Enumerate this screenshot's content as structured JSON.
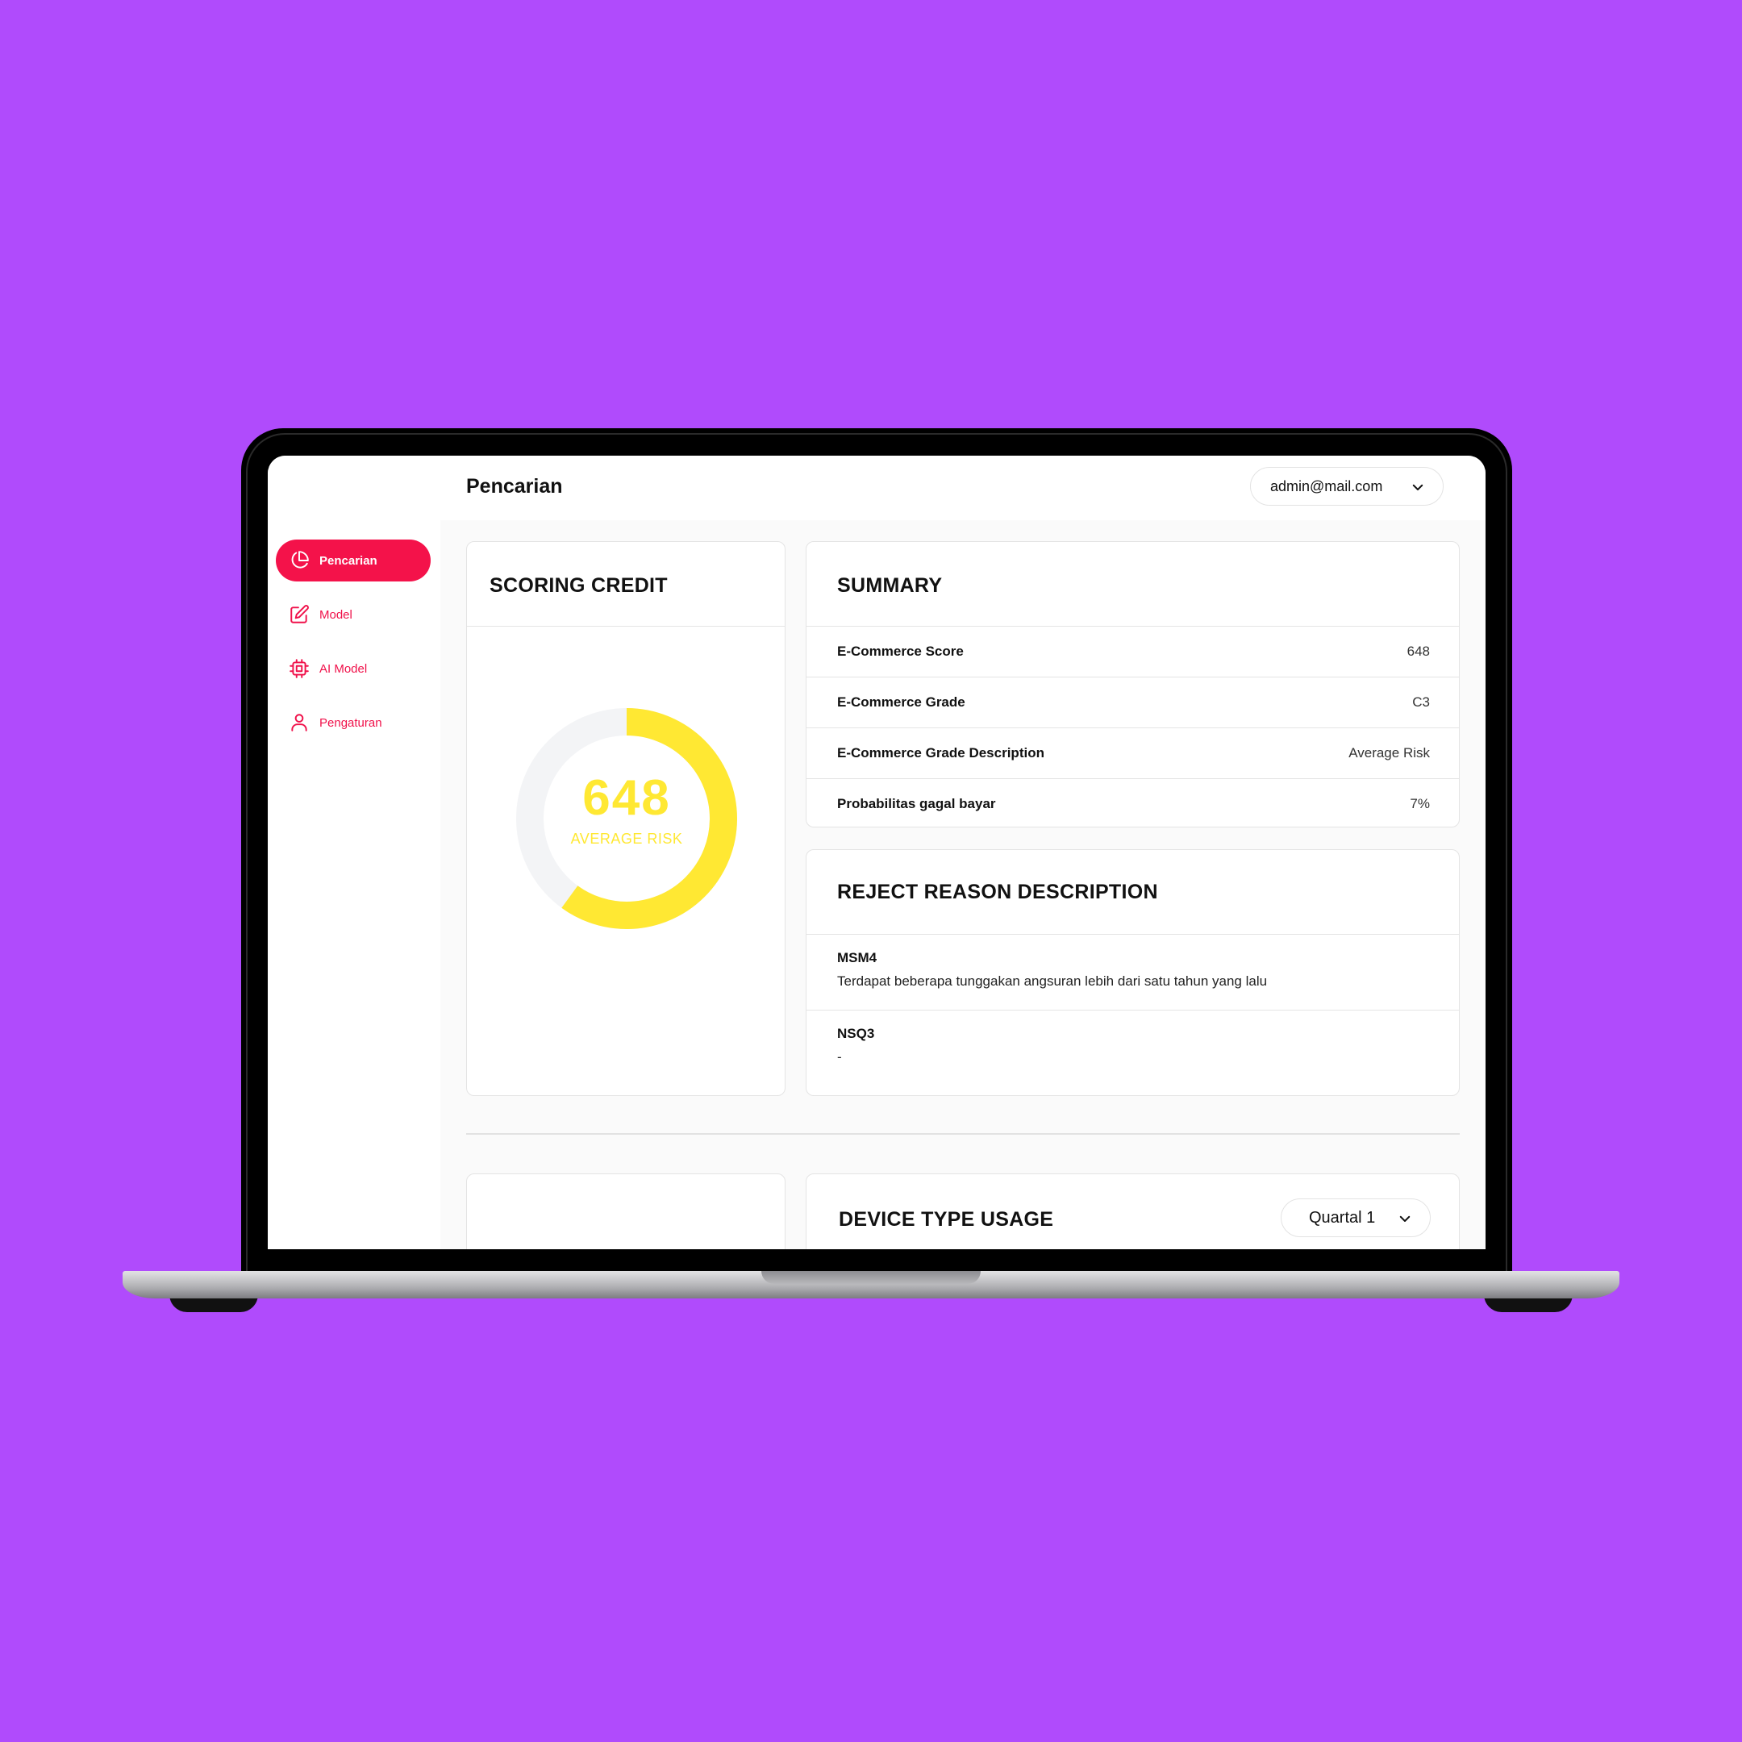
{
  "colors": {
    "background": "#b04bfc",
    "accent": "#f4124a",
    "gauge_fill": "#ffe833",
    "gauge_track": "#f3f4f6"
  },
  "sidebar": {
    "items": [
      {
        "label": "Pencarian",
        "icon": "pie-chart-icon",
        "active": true
      },
      {
        "label": "Model",
        "icon": "edit-icon",
        "active": false
      },
      {
        "label": "AI Model",
        "icon": "cpu-chip-icon",
        "active": false
      },
      {
        "label": "Pengaturan",
        "icon": "user-icon",
        "active": false
      }
    ]
  },
  "header": {
    "title": "Pencarian",
    "user_email": "admin@mail.com"
  },
  "scoring_credit": {
    "title": "SCORING CREDIT",
    "score": "648",
    "label": "AVERAGE RISK",
    "gauge_fraction": 0.6
  },
  "summary": {
    "title": "SUMMARY",
    "rows": [
      {
        "label": "E-Commerce Score",
        "value": "648"
      },
      {
        "label": "E-Commerce Grade",
        "value": "C3"
      },
      {
        "label": "E-Commerce Grade Description",
        "value": "Average Risk"
      },
      {
        "label": "Probabilitas gagal bayar",
        "value": "7%"
      }
    ]
  },
  "reject_reason": {
    "title": "REJECT REASON DESCRIPTION",
    "items": [
      {
        "code": "MSM4",
        "description": "Terdapat beberapa tunggakan angsuran lebih dari satu tahun yang lalu"
      },
      {
        "code": "NSQ3",
        "description": "-"
      }
    ]
  },
  "device_usage": {
    "title": "DEVICE TYPE USAGE",
    "period": "Quartal 1"
  }
}
